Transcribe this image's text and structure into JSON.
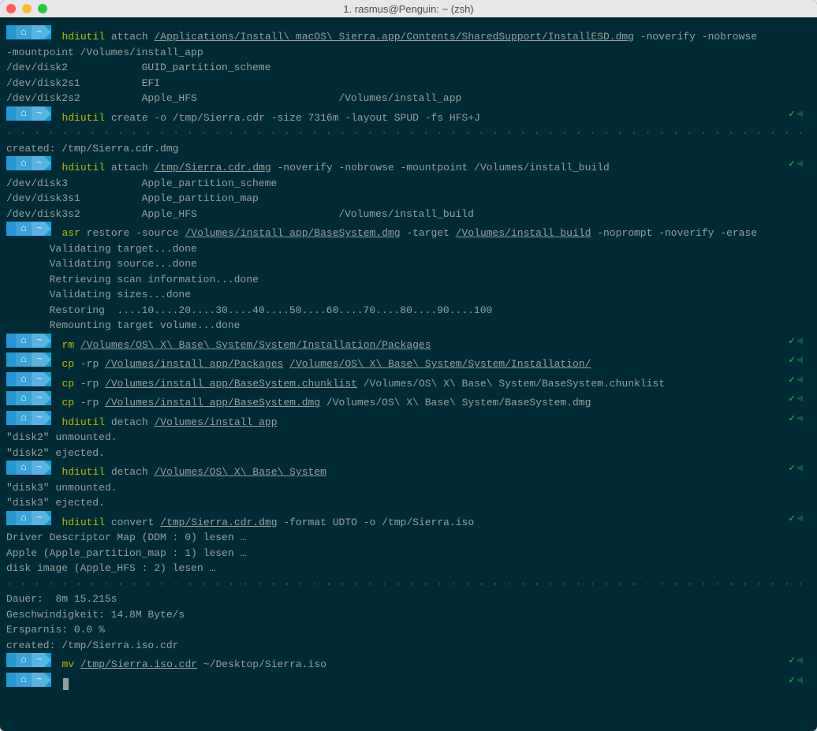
{
  "window": {
    "title": "1. rasmus@Penguin: ~ (zsh)"
  },
  "prompt": {
    "apple": "",
    "home": "⌂",
    "tilde": "~"
  },
  "dots_row": "· · · · · · · · · · · · · · · · · · · · · · · · · · · · · · · · · · · · · · · · · · · · · · · · · · · · · · · · · · · · · · · · · · · · · · · · · · · · · · · · · · · · · · · · · · · · · · · · · · · · · · · · · · · · · · · · · · · · · · · · · · · · · · · · · ·",
  "lines": [
    {
      "type": "cmd",
      "cmd": "hdiutil",
      "args": "attach ",
      "ul": "/Applications/Install\\ macOS\\ Sierra.app/Contents/SharedSupport/InstallESD.dmg",
      "rest": " -noverify -nobrowse",
      "check": false
    },
    {
      "type": "out",
      "text": "-mountpoint /Volumes/install_app"
    },
    {
      "type": "out",
      "text": "/dev/disk2            GUID_partition_scheme"
    },
    {
      "type": "out",
      "text": "/dev/disk2s1          EFI"
    },
    {
      "type": "out",
      "text": "/dev/disk2s2          Apple_HFS                       /Volumes/install_app"
    },
    {
      "type": "cmd",
      "cmd": "hdiutil",
      "args": "create -o /tmp/Sierra.cdr -size 7316m -layout SPUD -fs HFS+J",
      "check": true
    },
    {
      "type": "dots"
    },
    {
      "type": "out",
      "text": "created: /tmp/Sierra.cdr.dmg"
    },
    {
      "type": "cmd",
      "cmd": "hdiutil",
      "args": "attach ",
      "ul": "/tmp/Sierra.cdr.dmg",
      "rest": " -noverify -nobrowse -mountpoint /Volumes/install_build",
      "check": true
    },
    {
      "type": "out",
      "text": "/dev/disk3            Apple_partition_scheme"
    },
    {
      "type": "out",
      "text": "/dev/disk3s1          Apple_partition_map"
    },
    {
      "type": "out",
      "text": "/dev/disk3s2          Apple_HFS                       /Volumes/install_build"
    },
    {
      "type": "cmd",
      "cmd": "asr",
      "args": "restore -source ",
      "ul": "/Volumes/install_app/BaseSystem.dmg",
      "mid": " -target ",
      "ul2": "/Volumes/install_build",
      "rest": " -noprompt -noverify -erase",
      "check": false
    },
    {
      "type": "out",
      "text": "       Validating target...done"
    },
    {
      "type": "out",
      "text": "       Validating source...done"
    },
    {
      "type": "out",
      "text": "       Retrieving scan information...done"
    },
    {
      "type": "out",
      "text": "       Validating sizes...done"
    },
    {
      "type": "out",
      "text": "       Restoring  ....10....20....30....40....50....60....70....80....90....100"
    },
    {
      "type": "out",
      "text": "       Remounting target volume...done"
    },
    {
      "type": "cmd",
      "cmd": "rm",
      "args": "",
      "ul": "/Volumes/OS\\ X\\ Base\\ System/System/Installation/Packages",
      "check": true
    },
    {
      "type": "cmd",
      "cmd": "cp",
      "args": "-rp ",
      "ul": "/Volumes/install_app/Packages",
      "mid": " ",
      "ul2": "/Volumes/OS\\ X\\ Base\\ System/System/Installation/",
      "check": true
    },
    {
      "type": "cmd",
      "cmd": "cp",
      "args": "-rp ",
      "ul": "/Volumes/install_app/BaseSystem.chunklist",
      "rest": " /Volumes/OS\\ X\\ Base\\ System/BaseSystem.chunklist",
      "check": true
    },
    {
      "type": "cmd",
      "cmd": "cp",
      "args": "-rp ",
      "ul": "/Volumes/install_app/BaseSystem.dmg",
      "rest": " /Volumes/OS\\ X\\ Base\\ System/BaseSystem.dmg",
      "check": true
    },
    {
      "type": "cmd",
      "cmd": "hdiutil",
      "args": "detach ",
      "ul": "/Volumes/install_app",
      "check": true
    },
    {
      "type": "out",
      "text": "\"disk2\" unmounted."
    },
    {
      "type": "out",
      "text": "\"disk2\" ejected."
    },
    {
      "type": "cmd",
      "cmd": "hdiutil",
      "args": "detach ",
      "ul": "/Volumes/OS\\ X\\ Base\\ System",
      "check": true
    },
    {
      "type": "out",
      "text": "\"disk3\" unmounted."
    },
    {
      "type": "out",
      "text": "\"disk3\" ejected."
    },
    {
      "type": "cmd",
      "cmd": "hdiutil",
      "args": "convert ",
      "ul": "/tmp/Sierra.cdr.dmg",
      "rest": " -format UDTO -o /tmp/Sierra.iso",
      "check": true
    },
    {
      "type": "out",
      "text": "Driver Descriptor Map (DDM : 0) lesen …"
    },
    {
      "type": "out",
      "text": "Apple (Apple_partition_map : 1) lesen …"
    },
    {
      "type": "out",
      "text": "disk image (Apple_HFS : 2) lesen …"
    },
    {
      "type": "dots"
    },
    {
      "type": "out",
      "text": "Dauer:  8m 15.215s"
    },
    {
      "type": "out",
      "text": "Geschwindigkeit: 14.8M Byte/s"
    },
    {
      "type": "out",
      "text": "Ersparnis: 0.0 %"
    },
    {
      "type": "out",
      "text": "created: /tmp/Sierra.iso.cdr"
    },
    {
      "type": "cmd",
      "cmd": "mv",
      "args": "",
      "ul": "/tmp/Sierra.iso.cdr",
      "rest": " ~/Desktop/Sierra.iso",
      "check": true
    },
    {
      "type": "cursor",
      "check": true
    }
  ]
}
